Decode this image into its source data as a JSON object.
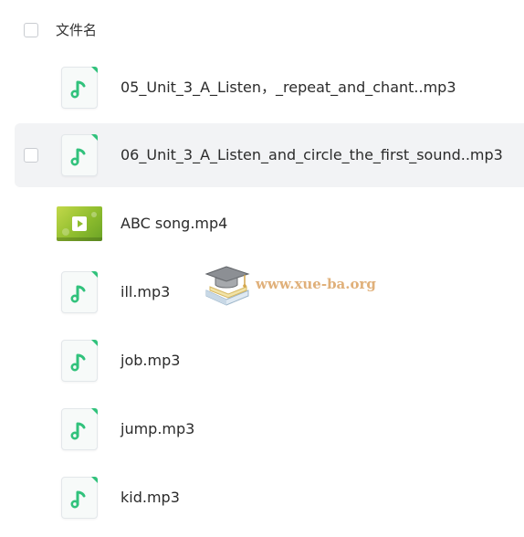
{
  "header": {
    "column_label": "文件名"
  },
  "files": [
    {
      "name": "05_Unit_3_A_Listen，_repeat_and_chant..mp3",
      "type": "audio"
    },
    {
      "name": "06_Unit_3_A_Listen_and_circle_the_first_sound..mp3",
      "type": "audio"
    },
    {
      "name": "ABC song.mp4",
      "type": "video"
    },
    {
      "name": "ill.mp3",
      "type": "audio"
    },
    {
      "name": "job.mp3",
      "type": "audio"
    },
    {
      "name": "jump.mp3",
      "type": "audio"
    },
    {
      "name": "kid.mp3",
      "type": "audio"
    }
  ],
  "watermark": {
    "text": "www.xue-ba.org",
    "icon": "graduation-cap-book-icon"
  },
  "colors": {
    "audio_icon_accent": "#31c27c",
    "hover_row_bg": "#f2f3f5",
    "watermark_text": "#e0b07a"
  },
  "icons": {
    "audio": "music-note-icon",
    "video": "video-thumbnail-play-icon"
  }
}
